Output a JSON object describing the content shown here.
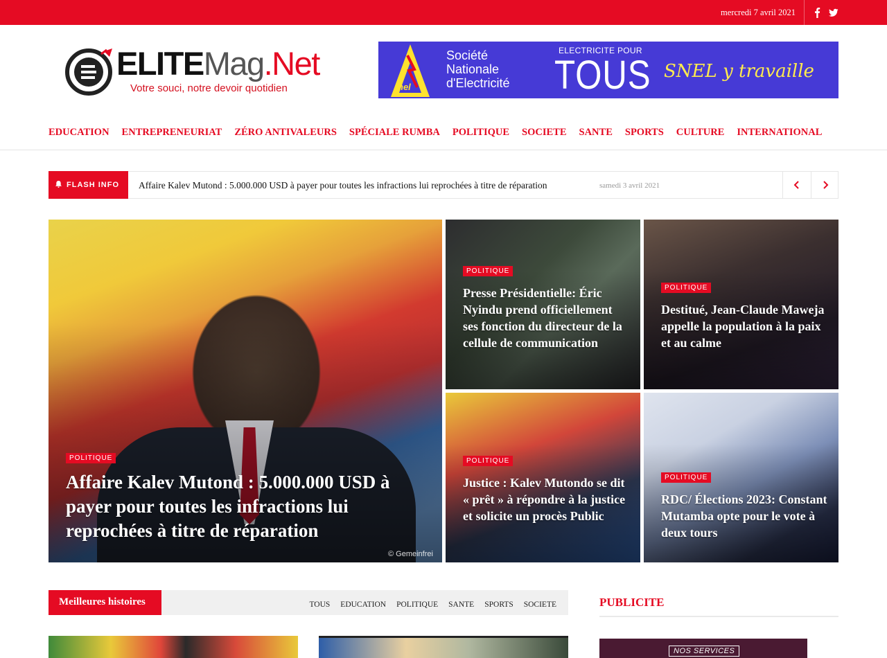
{
  "topbar": {
    "date": "mercredi 7 avril 2021",
    "color": "#e50b23",
    "social": [
      "facebook-icon",
      "twitter-icon"
    ]
  },
  "logo": {
    "part1": "ELITE",
    "part2": "Mag",
    "part3": ".Net",
    "tagline": "Votre souci, notre devoir quotidien"
  },
  "banner": {
    "company_line1": "Société",
    "company_line2": "Nationale",
    "company_line3": "d'Electricité",
    "slogan_small": "ELECTRICITE POUR",
    "slogan_big": "TOUS",
    "slogan_script": "SNEL y travaille",
    "brand_mark": "nel"
  },
  "nav": {
    "items": [
      "EDUCATION",
      "ENTREPRENEURIAT",
      "ZÉRO ANTIVALEURS",
      "SPÉCIALE RUMBA",
      "POLITIQUE",
      "SOCIETE",
      "SANTE",
      "SPORTS",
      "CULTURE",
      "INTERNATIONAL"
    ]
  },
  "flash": {
    "label": "FLASH INFO",
    "headline": "Affaire Kalev Mutond : 5.000.000 USD à payer pour toutes les infractions lui reprochées à titre de réparation",
    "date": "samedi 3 avril 2021"
  },
  "hero": {
    "main": {
      "category": "POLITIQUE",
      "title": "Affaire Kalev Mutond : 5.000.000 USD à payer pour toutes les infractions lui reprochées à titre de réparation",
      "credit": "© Gemeinfrei"
    },
    "cards": [
      {
        "category": "POLITIQUE",
        "title": "Presse Présidentielle: Éric Nyindu prend officiellement ses fonction du directeur de la cellule de communication"
      },
      {
        "category": "POLITIQUE",
        "title": "Destitué, Jean-Claude Maweja appelle la population à la paix et au calme"
      },
      {
        "category": "POLITIQUE",
        "title": "Justice : Kalev Mutondo se dit « prêt » à répondre à la justice et solicite un procès Public"
      },
      {
        "category": "POLITIQUE",
        "title": "RDC/ Élections 2023: Constant Mutamba opte pour le vote à deux tours"
      }
    ]
  },
  "best": {
    "label": "Meilleures histoires",
    "filters": [
      "TOUS",
      "EDUCATION",
      "POLITIQUE",
      "SANTE",
      "SPORTS",
      "SOCIETE"
    ]
  },
  "sidebar": {
    "title": "PUBLICITE",
    "ad_text": "NOS SERVICES"
  }
}
